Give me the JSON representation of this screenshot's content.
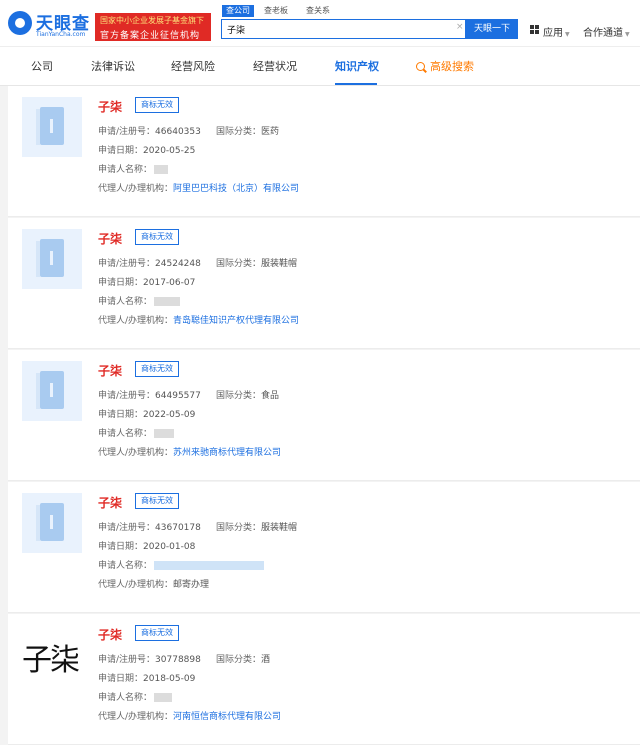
{
  "header": {
    "logo_text": "天眼查",
    "logo_sub": "TianYanCha.com",
    "promo_line1": "国家中小企业发展子基金旗下",
    "promo_line2": "官方备案企业征信机构",
    "search_tabs": [
      "查公司",
      "查老板",
      "查关系"
    ],
    "search_value": "子柒",
    "search_button": "天眼一下",
    "apps_label": "应用",
    "coop_label": "合作通道"
  },
  "nav": {
    "items": [
      "公司",
      "法律诉讼",
      "经营风险",
      "经营状况",
      "知识产权"
    ],
    "active_index": 4,
    "advanced_search": "高级搜索"
  },
  "labels": {
    "reg_no": "申请/注册号：",
    "class": "国际分类：",
    "date": "申请日期：",
    "applicant": "申请人名称：",
    "agent": "代理人/办理机构："
  },
  "trademarks": [
    {
      "name": "子柒",
      "status": "商标无效",
      "reg_no": "46640353",
      "class": "医药",
      "date": "2020-05-25",
      "agent": "阿里巴巴科技（北京）有限公司",
      "agent_link": true,
      "image": "book-icon"
    },
    {
      "name": "子柒",
      "status": "商标无效",
      "reg_no": "24524248",
      "class": "服装鞋帽",
      "date": "2017-06-07",
      "agent": "青岛聪佳知识产权代理有限公司",
      "agent_link": true,
      "image": "book-icon"
    },
    {
      "name": "子柒",
      "status": "商标无效",
      "reg_no": "64495577",
      "class": "食品",
      "date": "2022-05-09",
      "agent": "苏州来驰商标代理有限公司",
      "agent_link": true,
      "image": "book-icon"
    },
    {
      "name": "子柒",
      "status": "商标无效",
      "reg_no": "43670178",
      "class": "服装鞋帽",
      "date": "2020-01-08",
      "agent": "邮寄办理",
      "agent_link": false,
      "image": "book-icon"
    },
    {
      "name": "子柒",
      "status": "商标无效",
      "reg_no": "30778898",
      "class": "酒",
      "date": "2018-05-09",
      "agent": "河南恒信商标代理有限公司",
      "agent_link": true,
      "image": "text-logo",
      "image_text": "子柒"
    }
  ]
}
